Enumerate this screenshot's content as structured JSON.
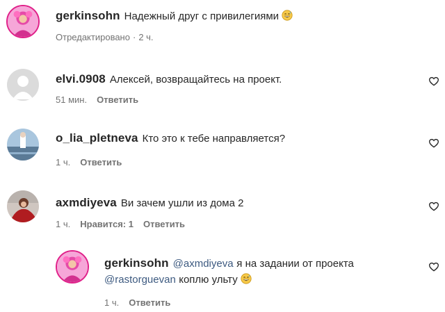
{
  "comments": [
    {
      "username": "gerkinsohn",
      "text": "Надежный друг с привилегиями",
      "emoji": "grinning-sweat-emoji",
      "meta": {
        "edited": "Отредактировано",
        "sep": "·",
        "time": "2 ч."
      }
    },
    {
      "username": "elvi.0908",
      "text": "Алексей, возвращайтесь на проект.",
      "meta": {
        "time": "51 мин.",
        "reply": "Ответить"
      }
    },
    {
      "username": "o_lia_pletneva",
      "text": "Кто это к тебе направляется?",
      "meta": {
        "time": "1 ч.",
        "reply": "Ответить"
      }
    },
    {
      "username": "axmdiyeva",
      "text": "Ви зачем ушли из дома 2",
      "meta": {
        "time": "1 ч.",
        "likes": "Нравится: 1",
        "reply": "Ответить"
      }
    },
    {
      "username": "gerkinsohn",
      "mention1": "@axmdiyeva",
      "text1": "я на задании от проекта",
      "mention2": "@rastorguevan",
      "text2": "коплю ульту",
      "emoji": "grinning-sweat-emoji",
      "meta": {
        "time": "1 ч.",
        "reply": "Ответить"
      }
    }
  ],
  "colors": {
    "username": "#262626",
    "meta": "#737373",
    "mention": "#3d5a80",
    "avatar_ring": "#e0218a"
  },
  "icons": [
    "heart-outline-icon",
    "grinning-sweat-emoji",
    "default-avatar-icon"
  ]
}
